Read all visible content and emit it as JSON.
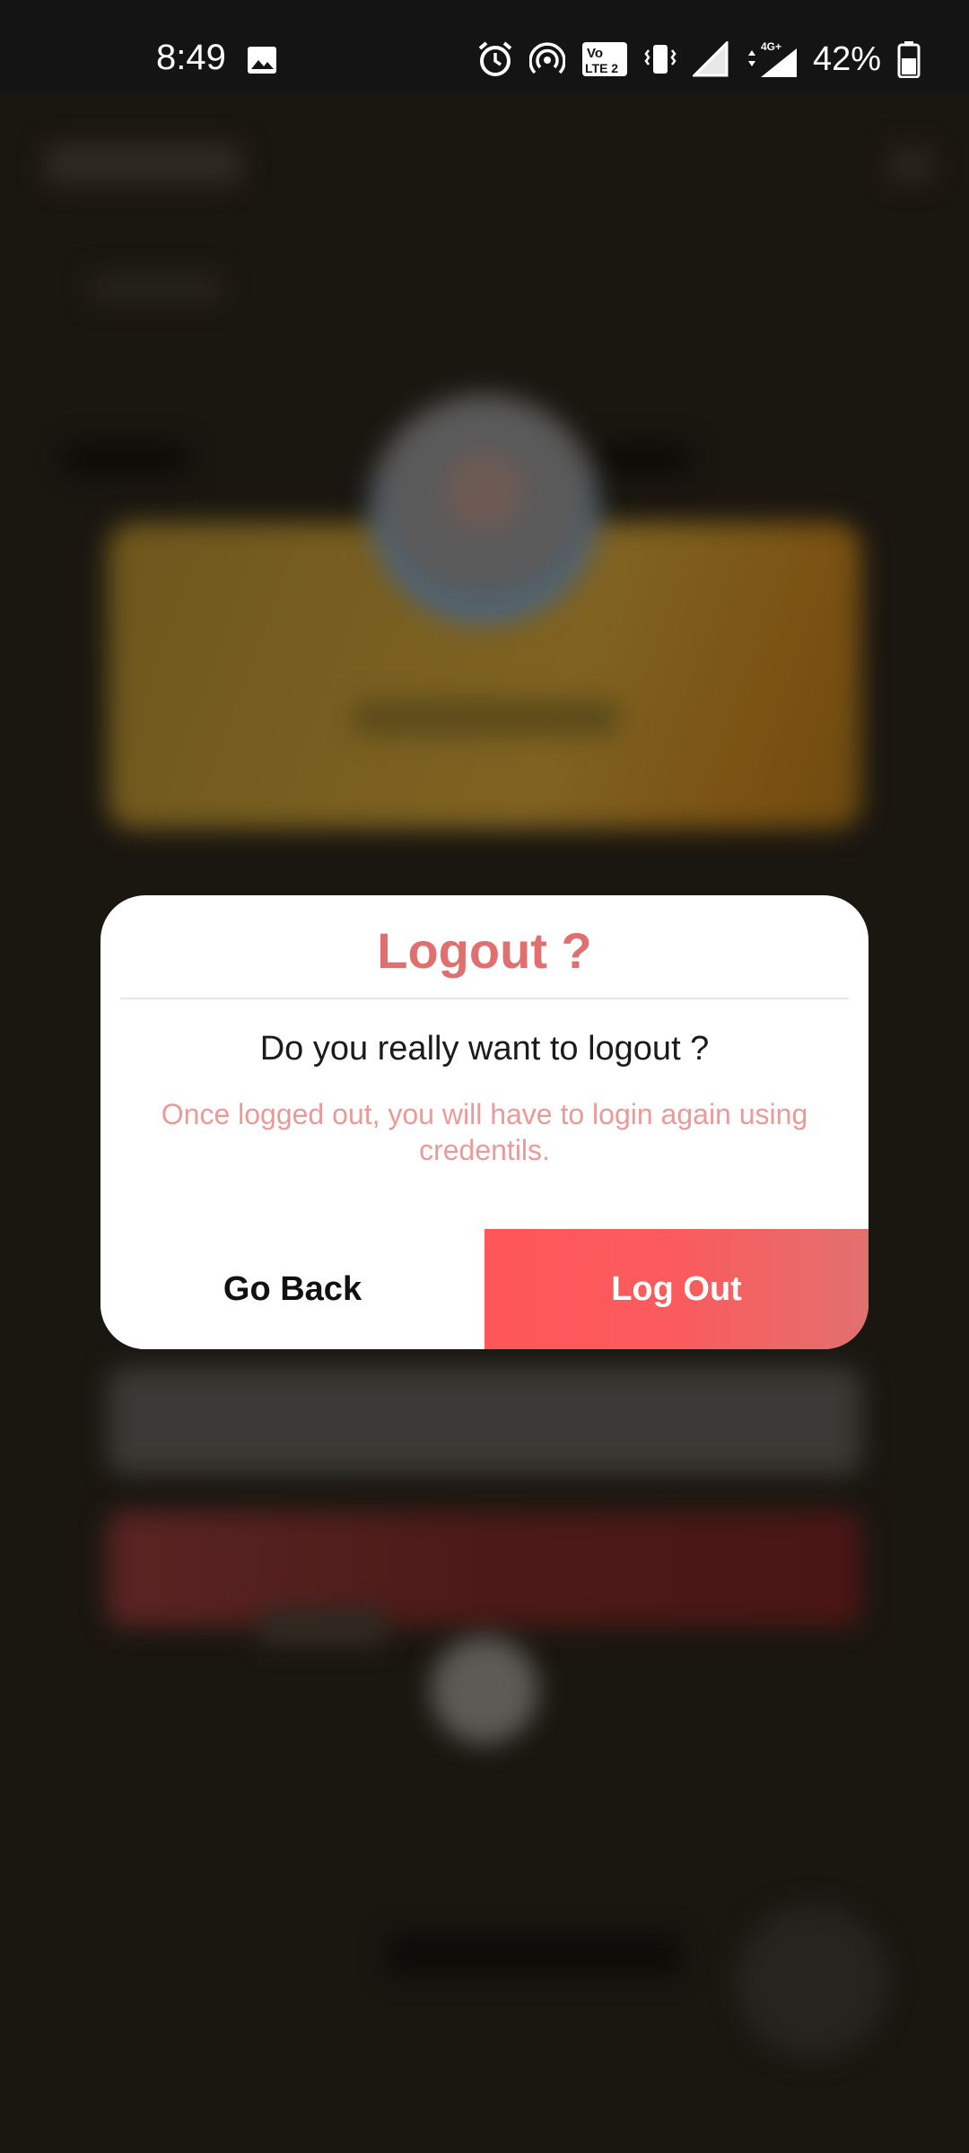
{
  "status_bar": {
    "time": "8:49",
    "battery_percent": "42%",
    "icons": [
      "gallery-icon",
      "alarm-icon",
      "hotspot-icon",
      "volte-icon",
      "vibrate-icon",
      "signal-icon",
      "data-4g-icon",
      "battery-icon"
    ],
    "volte_label_top": "Vo",
    "volte_label_bottom": "LTE 2",
    "data_label": "4G+"
  },
  "dialog": {
    "title": "Logout ?",
    "message": "Do you really want to logout ?",
    "note": "Once logged out, you will have to login again using credentils.",
    "go_back_label": "Go Back",
    "logout_label": "Log Out"
  },
  "colors": {
    "title": "#e06f70",
    "note": "#ea9a98",
    "logout_gradient_start": "#fe5659",
    "logout_gradient_end": "#e2706f",
    "overlay_background": "#1a1710"
  }
}
